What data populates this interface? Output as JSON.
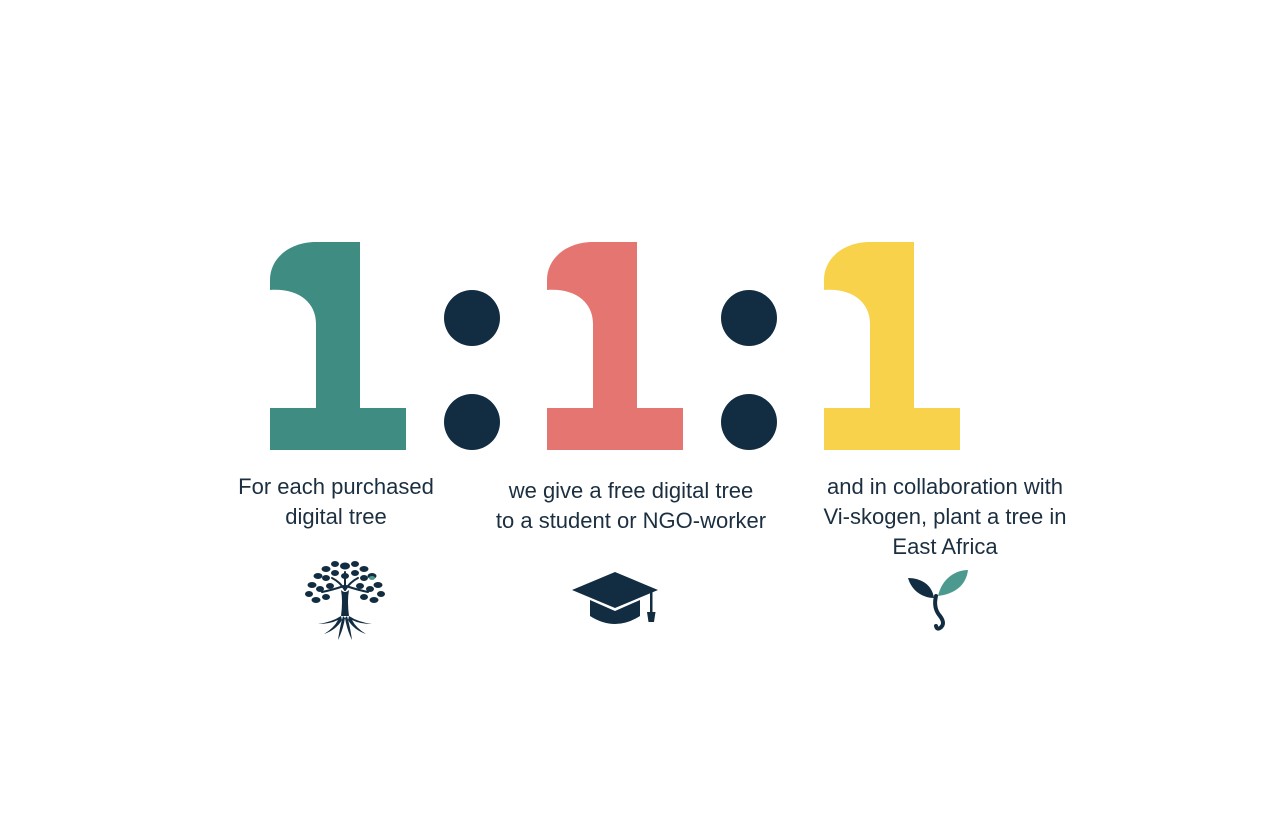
{
  "numerals": {
    "first": "1",
    "second": "1",
    "third": "1",
    "separator": ":"
  },
  "colors": {
    "first": "#3e8c82",
    "second": "#e57570",
    "third": "#f8d24a",
    "dark": "#122d42",
    "leaf_accent": "#4c9a8f"
  },
  "captions": {
    "first": "For each purchased\ndigital tree",
    "second": "we give a free digital tree\nto a student or NGO-worker",
    "third": "and in collaboration with\nVi-skogen, plant a tree in\nEast Africa"
  },
  "icons": {
    "first": "tree-with-roots-icon",
    "second": "graduation-cap-icon",
    "third": "sprout-icon"
  }
}
